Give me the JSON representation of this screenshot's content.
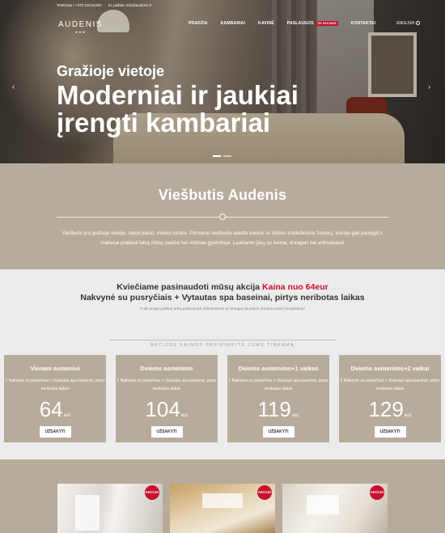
{
  "topbar": {
    "phone": "Telefonas / +370 319 61300",
    "email": "El. paštas: info@audenis.lt"
  },
  "logo": {
    "word": "AUDENIS",
    "stars": "★★★"
  },
  "nav": {
    "items": [
      "PRADŽIA",
      "KAMBARIAI",
      "KAVINĖ",
      "PASLAUGOS",
      "KONTAKTAI"
    ],
    "badge": "TIK PAS MUS",
    "language": "ENGLISH"
  },
  "hero": {
    "subtitle": "Gražioje vietoje",
    "title": "Moderniai ir jaukiai įrengti kambariai",
    "prev": "‹",
    "next": "›"
  },
  "about": {
    "title": "Viešbutis Audenis",
    "text": "Viešbutis yra gražioje vietoje, netoli parko, miesto centre. Pirmame viešbučio aukšte kavinė su židiniu trisdešimčiai žmonių, kurioje gali pasilygti ir maloniai praleisti laiką mūsų svečiai bei vietiniai gyventojai. Laukiame jūsų su šeima, draugais bei artimaisiais!"
  },
  "offer": {
    "line1_prefix": "Kviečiame pasinaudoti mūsų akcija",
    "line1_price": "Kaina nuo 64eur",
    "line2": "Nakvynė su pusryčiais + Vytautas spa baseinai, pirtys neribotas laikas",
    "small": "Puiki proga palšinti arba padovanoti artimiesiems ar draugui tai puikiu dovana-visas komplektas!",
    "section_title": "AKCIJOS KAINOS PASIRINKITE JUMS TINKAMĄ"
  },
  "cards": [
    {
      "title": "Vienam asmeniui",
      "desc": "1 Nakvynė su pusryčiais + Vytautas spa baseinai, pirtys neribotas laikas",
      "price": "64",
      "unit": "eur",
      "button": "UŽSAKYTI"
    },
    {
      "title": "Dviems asmenims",
      "desc": "1 Nakvynė su pusryčiais + Vytautas spa baseinai, pirtys neribotas laikas",
      "price": "104",
      "unit": "eur",
      "button": "UŽSAKYTI"
    },
    {
      "title": "Dviems asmenims+1 vaikas",
      "desc": "1 Nakvynė su pusryčiais + Vytautas spa baseinai, pirtys neribotas laikas",
      "price": "119",
      "unit": "eur",
      "button": "UŽSAKYTI"
    },
    {
      "title": "Dviems asmenims+2 vaikai",
      "desc": "1 Nakvynė su pusryčiais + Vytautas spa baseinai, pirtys neribotas laikas",
      "price": "129",
      "unit": "eur",
      "button": "UŽSAKYTI"
    }
  ],
  "rooms": [
    {
      "badge": "AKCIJA"
    },
    {
      "badge": "AKCIJA"
    },
    {
      "badge": "AKCIJA"
    }
  ]
}
